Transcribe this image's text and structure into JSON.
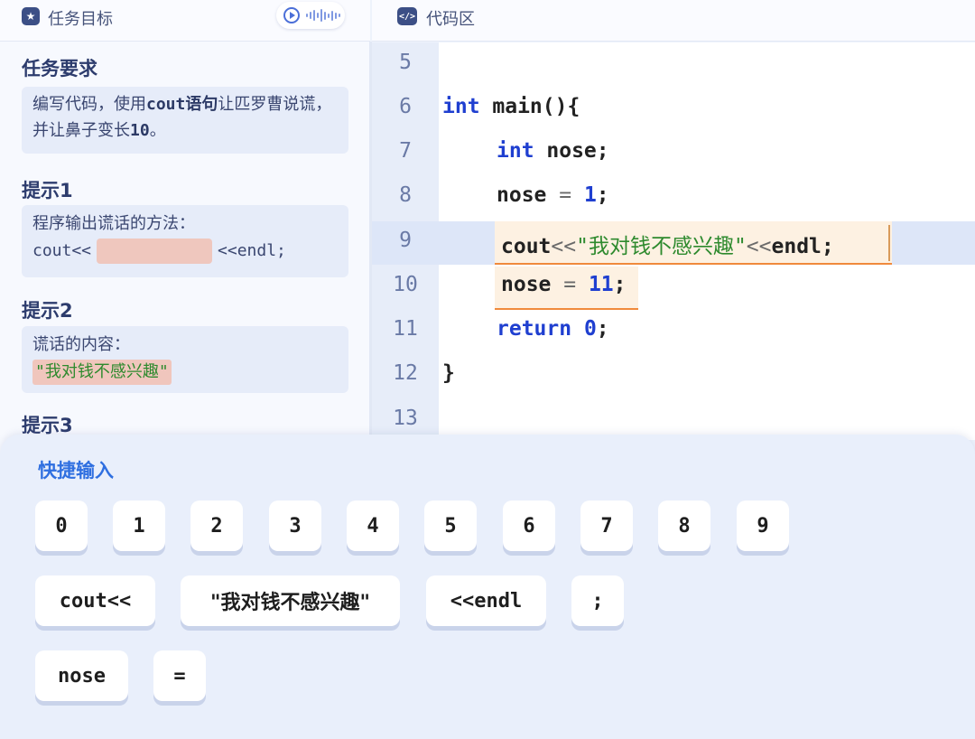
{
  "left_panel": {
    "header_title": "任务目标",
    "task": {
      "title": "任务要求",
      "text_before": "编写代码，使用",
      "text_bold": "cout语句",
      "text_after": "让匹罗曹说谎，并让鼻子变长",
      "text_num": "10",
      "text_end": "。"
    },
    "hint1": {
      "title": "提示1",
      "line1": "程序输出谎话的方法：",
      "code_prefix": "cout<<",
      "code_suffix": "<<endl;"
    },
    "hint2": {
      "title": "提示2",
      "line1": "谎话的内容：",
      "lie": "\"我对钱不感兴趣\""
    },
    "hint3": {
      "title": "提示3"
    }
  },
  "code_panel": {
    "header_title": "代码区",
    "header_icon": "</>",
    "line_numbers": [
      "5",
      "6",
      "7",
      "8",
      "9",
      "10",
      "11",
      "12",
      "13"
    ],
    "lines": {
      "l6_kw": "int",
      "l6_rest": " main(){",
      "l7_kw": "int",
      "l7_rest": " nose;",
      "l8_var": "nose",
      "l8_op": " = ",
      "l8_num": "1",
      "l8_end": ";",
      "l9_cout": "cout",
      "l9_op1": "<<",
      "l9_str": "\"我对钱不感兴趣\"",
      "l9_op2": "<<",
      "l9_endl": "endl;",
      "l10_var": "nose",
      "l10_op": " = ",
      "l10_num": "11",
      "l10_end": ";",
      "l11_kw": "return",
      "l11_num": " 0",
      "l11_end": ";",
      "l12": "}"
    },
    "colors": {
      "keyword": "#1f3fd0",
      "string": "#2e8a2e",
      "block_underline": "#f08a3c",
      "highlight_row": "#dde6f8"
    }
  },
  "quick_input": {
    "title": "快捷输入",
    "digits": [
      "0",
      "1",
      "2",
      "3",
      "4",
      "5",
      "6",
      "7",
      "8",
      "9"
    ],
    "row2": [
      "cout<<",
      "\"我对钱不感兴趣\"",
      "<<endl",
      ";"
    ],
    "row3": [
      "nose",
      "="
    ]
  },
  "icons": [
    "star-icon",
    "play-icon",
    "audio-wave-icon",
    "code-icon"
  ]
}
